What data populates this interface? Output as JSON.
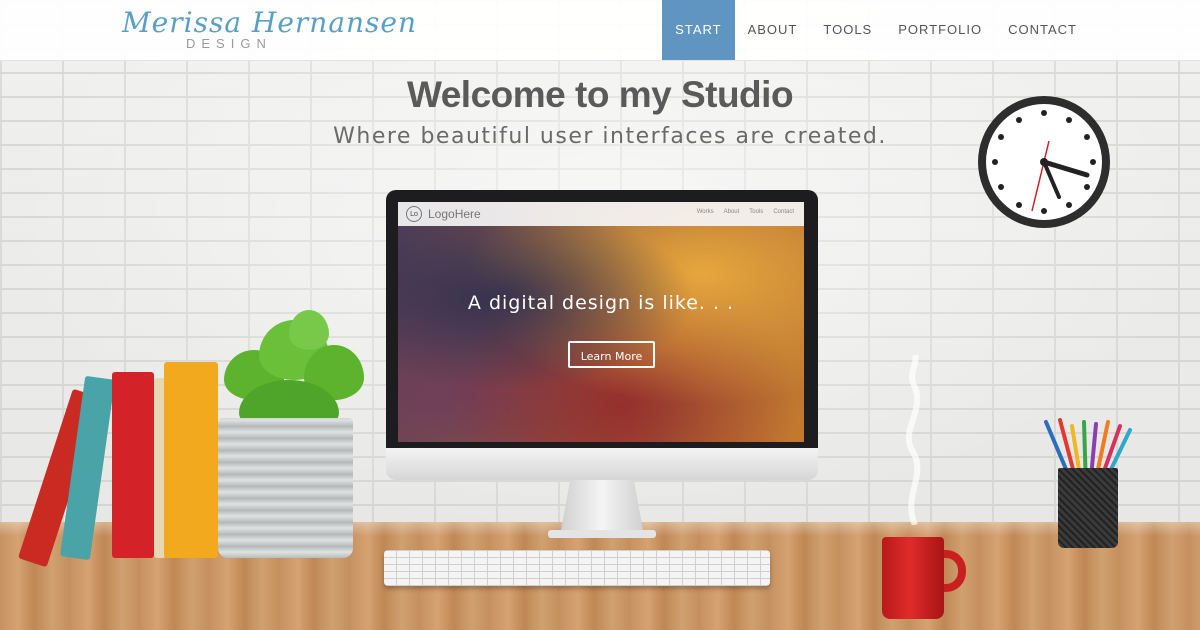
{
  "brand": {
    "script": "Merissa Hernansen",
    "sub": "DESIGN"
  },
  "nav": {
    "items": [
      {
        "label": "START",
        "active": true
      },
      {
        "label": "ABOUT",
        "active": false
      },
      {
        "label": "TOOLS",
        "active": false
      },
      {
        "label": "PORTFOLIO",
        "active": false
      },
      {
        "label": "CONTACT",
        "active": false
      }
    ]
  },
  "hero": {
    "title": "Welcome to my Studio",
    "subtitle": "Where beautiful user interfaces are created."
  },
  "monitor_screen": {
    "logo_mark": "Lo",
    "logo": "LogoHere",
    "links": [
      "Works",
      "About",
      "Tools",
      "Contact"
    ],
    "headline": "A digital design is like. . .",
    "button": "Learn More"
  },
  "colors": {
    "accent": "#5f95c0",
    "title_gray": "#5a5a5a",
    "logo_blue": "#5a9fc4"
  }
}
